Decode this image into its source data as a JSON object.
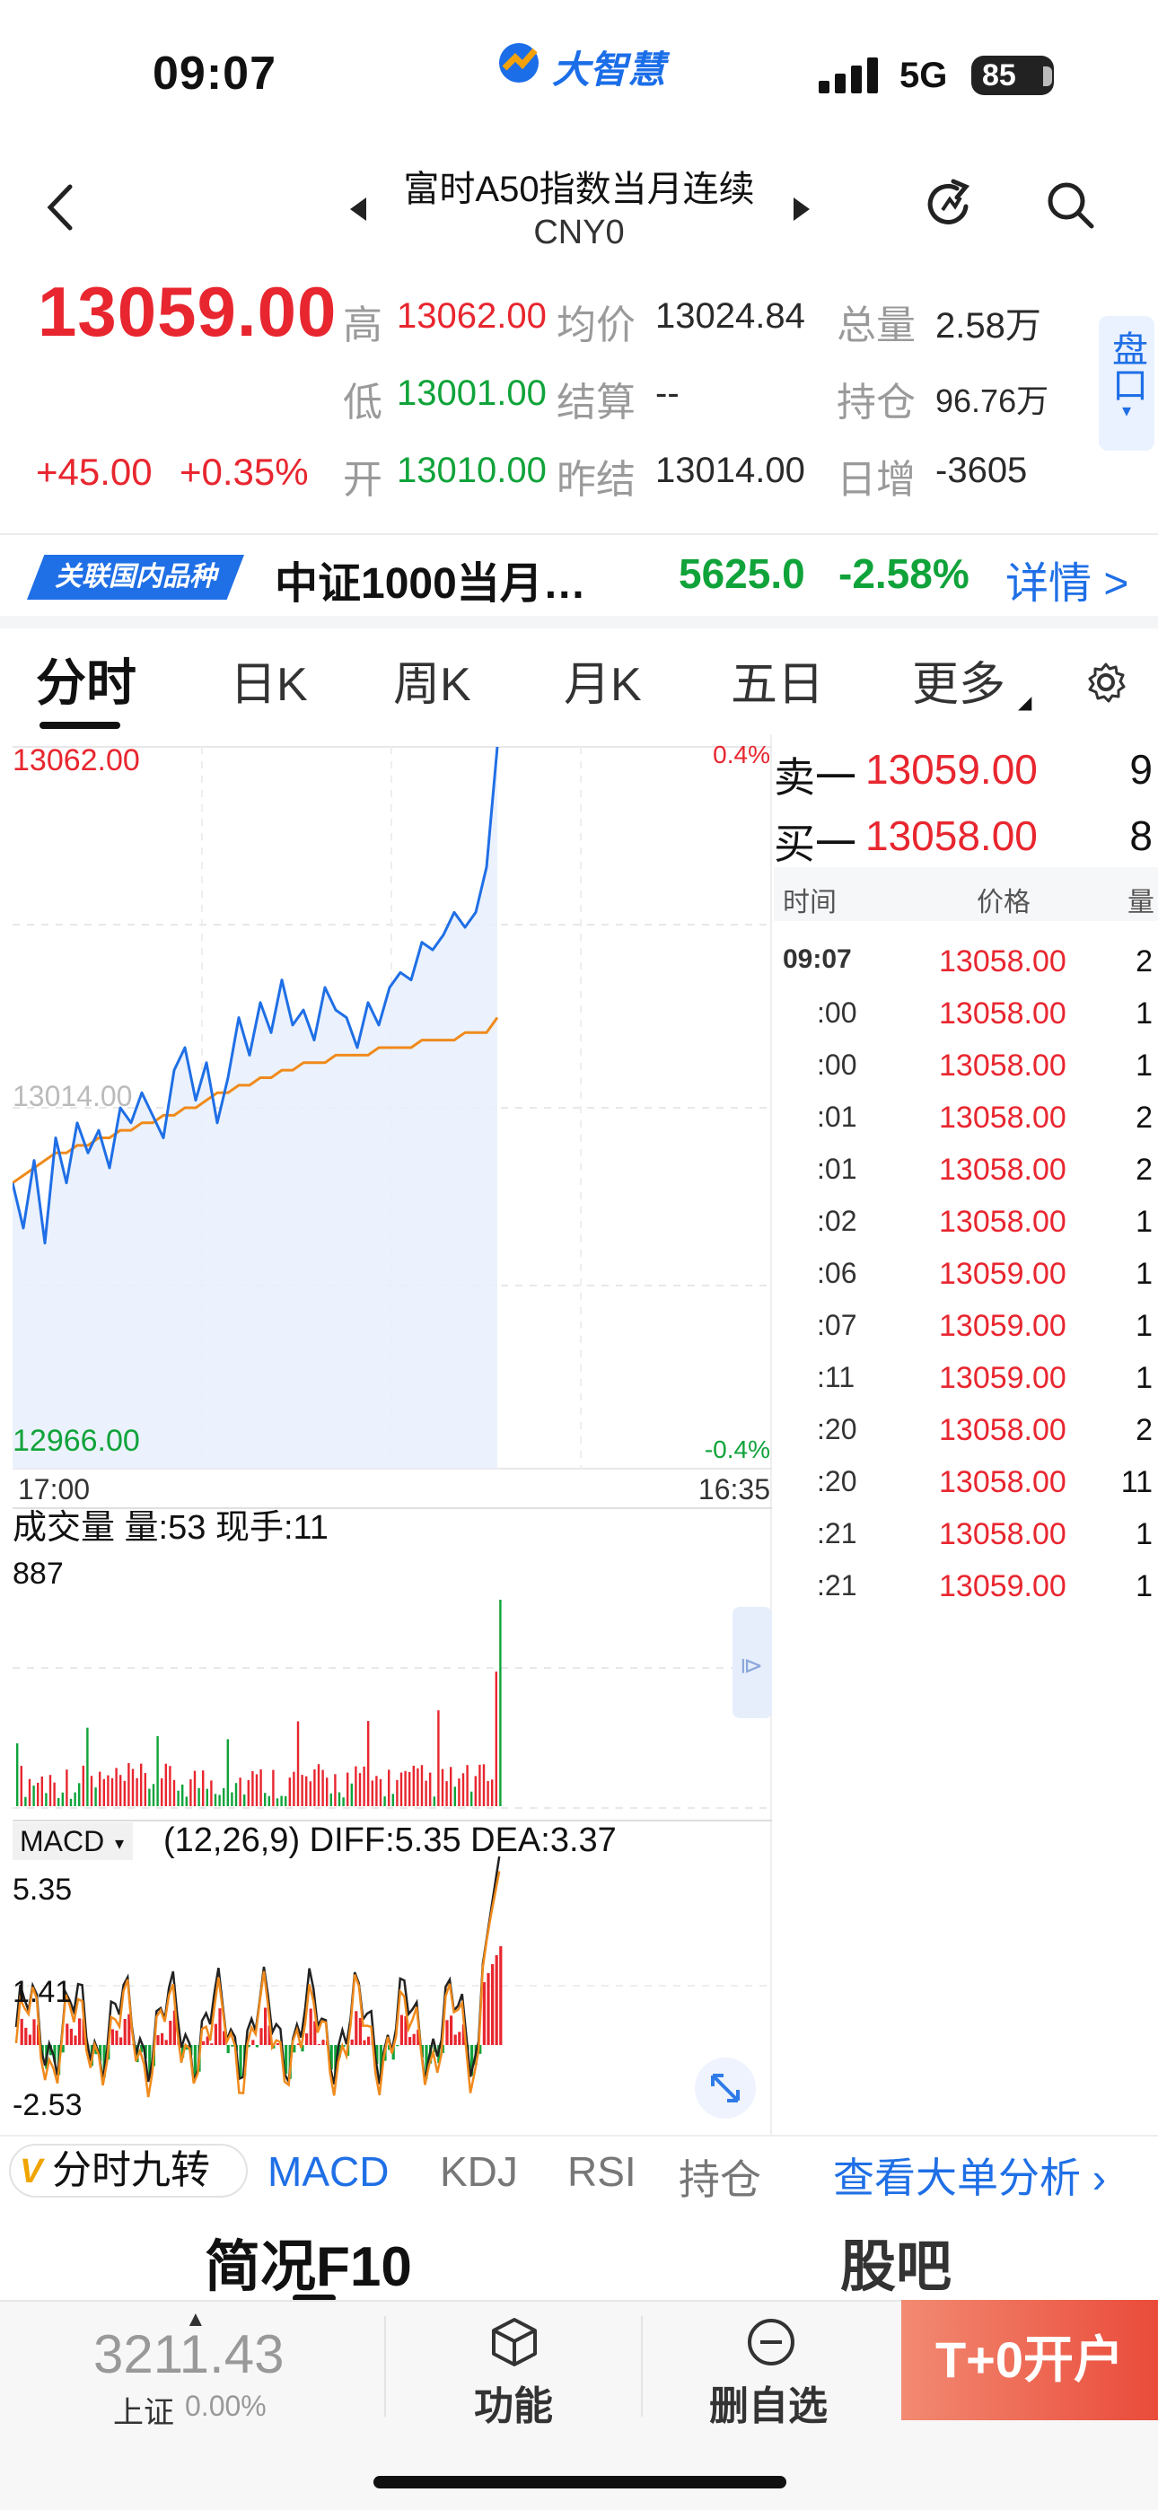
{
  "status_bar": {
    "time": "09:07",
    "network": "5G",
    "battery": "85",
    "brand": "大智慧"
  },
  "header": {
    "title": "富时A50指数当月连续",
    "code": "CNY0"
  },
  "quote": {
    "last_price": "13059.00",
    "change": "+45.00",
    "change_pct": "+0.35%",
    "high_label": "高",
    "high": "13062.00",
    "low_label": "低",
    "low": "13001.00",
    "open_label": "开",
    "open": "13010.00",
    "avg_label": "均价",
    "avg": "13024.84",
    "settle_label": "结算",
    "settle": "--",
    "prev_settle_label": "昨结",
    "prev_settle": "13014.00",
    "volume_label": "总量",
    "volume": "2.58万",
    "oi_label": "持仓",
    "oi": "96.76万",
    "daily_inc_label": "日增",
    "daily_inc": "-3605",
    "pankou": "盘口"
  },
  "related": {
    "tag": "关联国内品种",
    "name": "中证1000当月…",
    "price": "5625.0",
    "pct": "-2.58%",
    "detail": "详情 >"
  },
  "chart_tabs": [
    "分时",
    "日K",
    "周K",
    "月K",
    "五日",
    "更多"
  ],
  "chart": {
    "top_label": "13062.00",
    "top_pct": "0.4%",
    "mid_label": "13014.00",
    "bottom_label": "12966.00",
    "bottom_pct": "-0.4%",
    "time_start": "17:00",
    "time_end": "16:35",
    "volume_title": "成交量  量:53  现手:11",
    "volume_max": "887",
    "macd_name": "MACD",
    "macd_params": "(12,26,9) DIFF:5.35 DEA:3.37",
    "macd_top": "5.35",
    "macd_mid": "1.41",
    "macd_bottom": "-2.53"
  },
  "chart_data": {
    "type": "line",
    "title": "",
    "ylim": [
      12966.0,
      13062.0
    ],
    "series": [
      {
        "name": "",
        "values": [
          13004,
          12998,
          13007,
          12996,
          13010,
          13004,
          13012,
          13008,
          13011,
          13006,
          13014,
          13012,
          13016,
          13013,
          13010,
          13019,
          13022,
          13015,
          13020,
          13012,
          13018,
          13026,
          13021,
          13028,
          13024,
          13031,
          13025,
          13027,
          13023,
          13030,
          13027,
          13026,
          13022,
          13028,
          13025,
          13030,
          13032,
          13031,
          13036,
          13035,
          13037,
          13040,
          13038,
          13040,
          13046,
          13062
        ]
      },
      {
        "name": "",
        "values": [
          13004,
          13005,
          13006,
          13007,
          13008,
          13008,
          13009,
          13009,
          13010,
          13010,
          13011,
          13011,
          13012,
          13012,
          13013,
          13013,
          13014,
          13014,
          13015,
          13016,
          13016,
          13017,
          13017,
          13018,
          13018,
          13019,
          13019,
          13020,
          13020,
          13020,
          13021,
          13021,
          13021,
          13021,
          13022,
          13022,
          13022,
          13022,
          13023,
          13023,
          13023,
          13023,
          13024,
          13024,
          13024,
          13026
        ]
      }
    ]
  },
  "order_book": {
    "sell_label": "卖一",
    "sell_price": "13059.00",
    "sell_qty": "9",
    "buy_label": "买一",
    "buy_price": "13058.00",
    "buy_qty": "8",
    "head_time": "时间",
    "head_price": "价格",
    "head_qty": "量",
    "ticks": [
      {
        "time": "09:07",
        "price": "13058.00",
        "qty": "2"
      },
      {
        "time": ":00",
        "price": "13058.00",
        "qty": "1"
      },
      {
        "time": ":00",
        "price": "13058.00",
        "qty": "1"
      },
      {
        "time": ":01",
        "price": "13058.00",
        "qty": "2"
      },
      {
        "time": ":01",
        "price": "13058.00",
        "qty": "2"
      },
      {
        "time": ":02",
        "price": "13058.00",
        "qty": "1"
      },
      {
        "time": ":06",
        "price": "13059.00",
        "qty": "1"
      },
      {
        "time": ":07",
        "price": "13059.00",
        "qty": "1"
      },
      {
        "time": ":11",
        "price": "13059.00",
        "qty": "1"
      },
      {
        "time": ":20",
        "price": "13058.00",
        "qty": "2"
      },
      {
        "time": ":20",
        "price": "13058.00",
        "qty": "11"
      },
      {
        "time": ":21",
        "price": "13058.00",
        "qty": "1"
      },
      {
        "time": ":21",
        "price": "13059.00",
        "qty": "1"
      }
    ]
  },
  "indicator_tabs": {
    "nine_turn": "分时九转",
    "macd": "MACD",
    "kdj": "KDJ",
    "rsi": "RSI",
    "oi": "持仓",
    "big_order": "查看大单分析 ›"
  },
  "sub_tabs": {
    "f10": "简况F10",
    "guba": "股吧"
  },
  "bottom": {
    "index_value": "3211.43",
    "index_label": "上证",
    "index_pct": "0.00%",
    "func": "功能",
    "remove": "删自选",
    "open_account": "T+0开户"
  }
}
